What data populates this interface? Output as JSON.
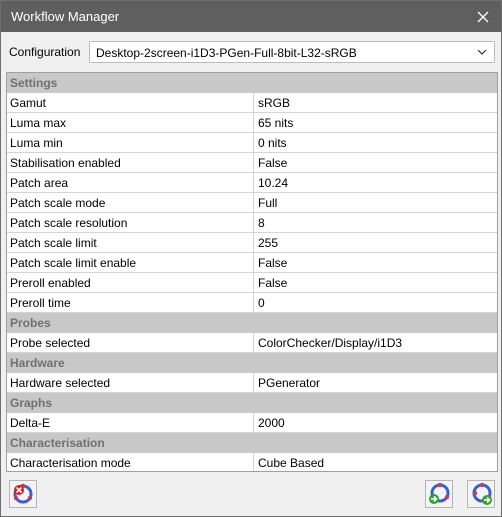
{
  "window": {
    "title": "Workflow Manager"
  },
  "configuration": {
    "label": "Configuration",
    "selected": "Desktop-2screen-i1D3-PGen-Full-8bit-L32-sRGB"
  },
  "sections": [
    {
      "title": "Settings",
      "rows": [
        {
          "key": "Gamut",
          "value": "sRGB"
        },
        {
          "key": "Luma max",
          "value": "65 nits"
        },
        {
          "key": "Luma min",
          "value": "0 nits"
        },
        {
          "key": "Stabilisation enabled",
          "value": "False"
        },
        {
          "key": "Patch area",
          "value": "10.24"
        },
        {
          "key": "Patch scale mode",
          "value": "Full"
        },
        {
          "key": "Patch scale resolution",
          "value": "8"
        },
        {
          "key": "Patch scale limit",
          "value": "255"
        },
        {
          "key": "Patch scale limit enable",
          "value": "False"
        },
        {
          "key": "Preroll enabled",
          "value": "False"
        },
        {
          "key": "Preroll time",
          "value": "0"
        }
      ]
    },
    {
      "title": "Probes",
      "rows": [
        {
          "key": "Probe selected",
          "value": "ColorChecker/Display/i1D3"
        }
      ]
    },
    {
      "title": "Hardware",
      "rows": [
        {
          "key": "Hardware selected",
          "value": "PGenerator"
        }
      ]
    },
    {
      "title": "Graphs",
      "rows": [
        {
          "key": "Delta-E",
          "value": "2000"
        }
      ]
    },
    {
      "title": "Characterisation",
      "rows": [
        {
          "key": "Characterisation mode",
          "value": "Cube Based"
        }
      ]
    }
  ],
  "buttons": {
    "left": {
      "icon": "delete-workflow-icon"
    },
    "right1": {
      "icon": "run-step-icon"
    },
    "right2": {
      "icon": "run-all-icon"
    }
  },
  "colors": {
    "titlebar": "#5f5f5f",
    "section_bg": "#c8c8c8",
    "section_text": "#707070"
  }
}
